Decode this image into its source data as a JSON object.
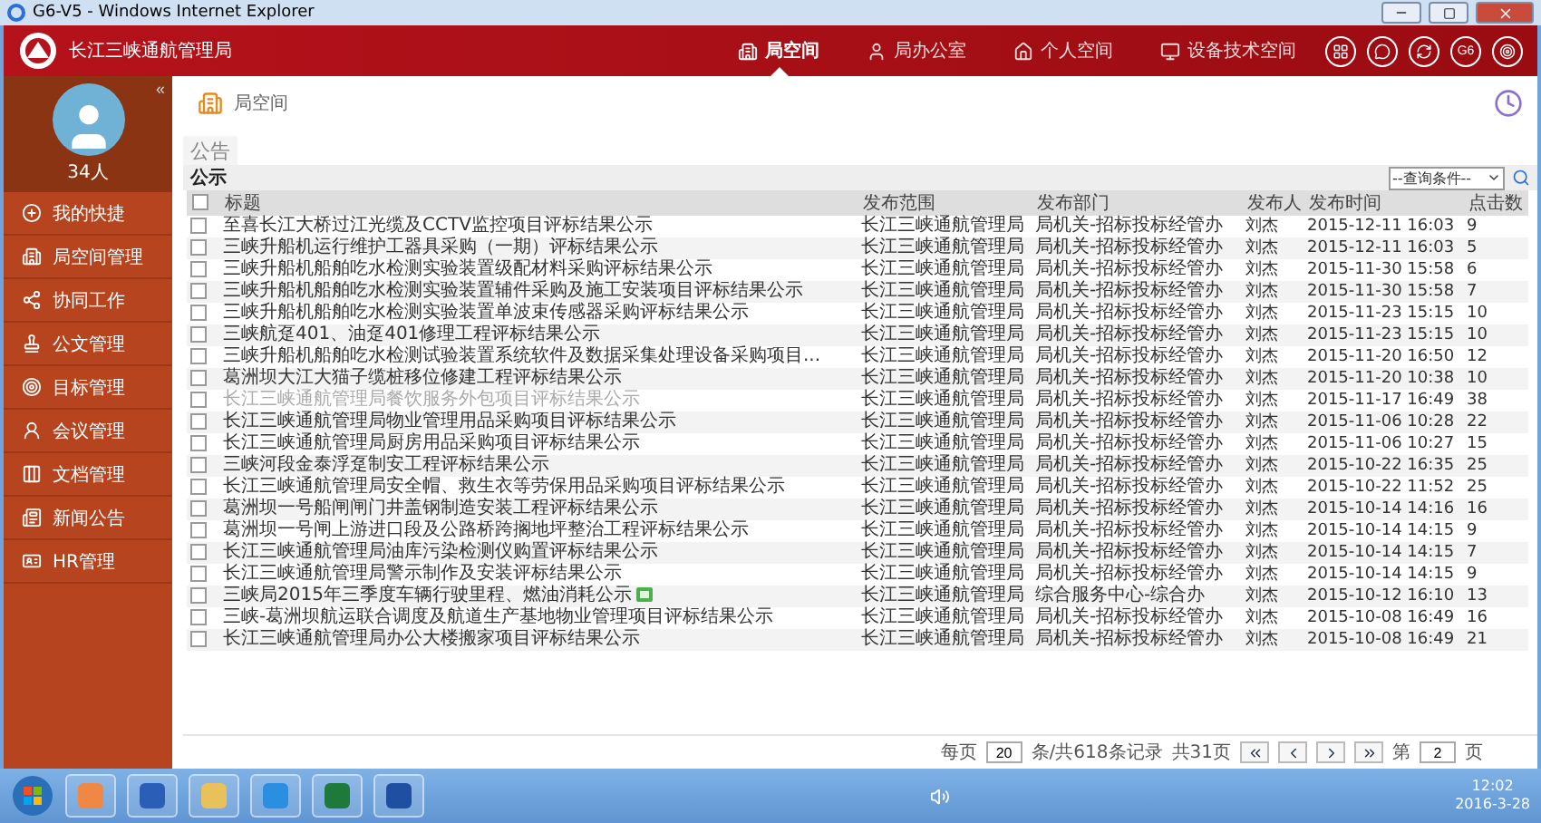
{
  "window": {
    "title": "G6-V5 - Windows Internet Explorer"
  },
  "header": {
    "org_name": "长江三峡通航管理局",
    "nav": [
      {
        "label": "局空间",
        "selected": true
      },
      {
        "label": "局办公室",
        "selected": false
      },
      {
        "label": "个人空间",
        "selected": false
      },
      {
        "label": "设备技术空间",
        "selected": false
      }
    ],
    "badge_text": "G6"
  },
  "sidebar": {
    "collapse": "«",
    "online": "34人",
    "items": [
      {
        "label": "我的快捷"
      },
      {
        "label": "局空间管理"
      },
      {
        "label": "协同工作"
      },
      {
        "label": "公文管理"
      },
      {
        "label": "目标管理"
      },
      {
        "label": "会议管理"
      },
      {
        "label": "文档管理"
      },
      {
        "label": "新闻公告"
      },
      {
        "label": "HR管理"
      }
    ]
  },
  "breadcrumb": "局空间",
  "section_title": "公告",
  "panel": {
    "title": "公示",
    "query_placeholder": "--查询条件--"
  },
  "table": {
    "select_all_checked": false,
    "columns": [
      "标题",
      "发布范围",
      "发布部门",
      "发布人",
      "发布时间",
      "点击数"
    ],
    "rows": [
      {
        "checked": false,
        "visited": false,
        "is_new": false,
        "cells": [
          "至喜长江大桥过江光缆及CCTV监控项目评标结果公示",
          "长江三峡通航管理局",
          "局机关-招标投标经管办",
          "刘杰",
          "2015-12-11 16:03",
          "9"
        ]
      },
      {
        "checked": false,
        "visited": false,
        "is_new": false,
        "cells": [
          "三峡升船机运行维护工器具采购（一期）评标结果公示",
          "长江三峡通航管理局",
          "局机关-招标投标经管办",
          "刘杰",
          "2015-12-11 16:03",
          "5"
        ]
      },
      {
        "checked": false,
        "visited": false,
        "is_new": false,
        "cells": [
          "三峡升船机船舶吃水检测实验装置级配材料采购评标结果公示",
          "长江三峡通航管理局",
          "局机关-招标投标经管办",
          "刘杰",
          "2015-11-30 15:58",
          "6"
        ]
      },
      {
        "checked": false,
        "visited": false,
        "is_new": false,
        "cells": [
          "三峡升船机船舶吃水检测实验装置辅件采购及施工安装项目评标结果公示",
          "长江三峡通航管理局",
          "局机关-招标投标经管办",
          "刘杰",
          "2015-11-30 15:58",
          "7"
        ]
      },
      {
        "checked": false,
        "visited": false,
        "is_new": false,
        "cells": [
          "三峡升船机船舶吃水检测实验装置单波束传感器采购评标结果公示",
          "长江三峡通航管理局",
          "局机关-招标投标经管办",
          "刘杰",
          "2015-11-23 15:15",
          "10"
        ]
      },
      {
        "checked": false,
        "visited": false,
        "is_new": false,
        "cells": [
          "三峡航趸401、油趸401修理工程评标结果公示",
          "长江三峡通航管理局",
          "局机关-招标投标经管办",
          "刘杰",
          "2015-11-23 15:15",
          "10"
        ]
      },
      {
        "checked": false,
        "visited": false,
        "is_new": false,
        "cells": [
          "三峡升船机船舶吃水检测试验装置系统软件及数据采集处理设备采购项目...",
          "长江三峡通航管理局",
          "局机关-招标投标经管办",
          "刘杰",
          "2015-11-20 16:50",
          "12"
        ]
      },
      {
        "checked": false,
        "visited": false,
        "is_new": false,
        "cells": [
          "葛洲坝大江大猫子缆桩移位修建工程评标结果公示",
          "长江三峡通航管理局",
          "局机关-招标投标经管办",
          "刘杰",
          "2015-11-20 10:38",
          "10"
        ]
      },
      {
        "checked": false,
        "visited": true,
        "is_new": false,
        "cells": [
          "长江三峡通航管理局餐饮服务外包项目评标结果公示",
          "长江三峡通航管理局",
          "局机关-招标投标经管办",
          "刘杰",
          "2015-11-17 16:49",
          "38"
        ]
      },
      {
        "checked": false,
        "visited": false,
        "is_new": false,
        "cells": [
          "长江三峡通航管理局物业管理用品采购项目评标结果公示",
          "长江三峡通航管理局",
          "局机关-招标投标经管办",
          "刘杰",
          "2015-11-06 10:28",
          "22"
        ]
      },
      {
        "checked": false,
        "visited": false,
        "is_new": false,
        "cells": [
          "长江三峡通航管理局厨房用品采购项目评标结果公示",
          "长江三峡通航管理局",
          "局机关-招标投标经管办",
          "刘杰",
          "2015-11-06 10:27",
          "15"
        ]
      },
      {
        "checked": false,
        "visited": false,
        "is_new": false,
        "cells": [
          "三峡河段金泰浮趸制安工程评标结果公示",
          "长江三峡通航管理局",
          "局机关-招标投标经管办",
          "刘杰",
          "2015-10-22 16:35",
          "25"
        ]
      },
      {
        "checked": false,
        "visited": false,
        "is_new": false,
        "cells": [
          "长江三峡通航管理局安全帽、救生衣等劳保用品采购项目评标结果公示",
          "长江三峡通航管理局",
          "局机关-招标投标经管办",
          "刘杰",
          "2015-10-22 11:52",
          "25"
        ]
      },
      {
        "checked": false,
        "visited": false,
        "is_new": false,
        "cells": [
          "葛洲坝一号船闸闸门井盖钢制造安装工程评标结果公示",
          "长江三峡通航管理局",
          "局机关-招标投标经管办",
          "刘杰",
          "2015-10-14 14:16",
          "16"
        ]
      },
      {
        "checked": false,
        "visited": false,
        "is_new": false,
        "cells": [
          "葛洲坝一号闸上游进口段及公路桥跨搁地坪整治工程评标结果公示",
          "长江三峡通航管理局",
          "局机关-招标投标经管办",
          "刘杰",
          "2015-10-14 14:15",
          "9"
        ]
      },
      {
        "checked": false,
        "visited": false,
        "is_new": false,
        "cells": [
          "长江三峡通航管理局油库污染检测仪购置评标结果公示",
          "长江三峡通航管理局",
          "局机关-招标投标经管办",
          "刘杰",
          "2015-10-14 14:15",
          "7"
        ]
      },
      {
        "checked": false,
        "visited": false,
        "is_new": false,
        "cells": [
          "长江三峡通航管理局警示制作及安装评标结果公示",
          "长江三峡通航管理局",
          "局机关-招标投标经管办",
          "刘杰",
          "2015-10-14 14:15",
          "9"
        ]
      },
      {
        "checked": false,
        "visited": false,
        "is_new": true,
        "cells": [
          "三峡局2015年三季度车辆行驶里程、燃油消耗公示",
          "长江三峡通航管理局",
          "综合服务中心-综合办",
          "刘杰",
          "2015-10-12 16:10",
          "13"
        ]
      },
      {
        "checked": false,
        "visited": false,
        "is_new": false,
        "cells": [
          "三峡-葛洲坝航运联合调度及航道生产基地物业管理项目评标结果公示",
          "长江三峡通航管理局",
          "局机关-招标投标经管办",
          "刘杰",
          "2015-10-08 16:49",
          "16"
        ]
      },
      {
        "checked": false,
        "visited": false,
        "is_new": false,
        "cells": [
          "长江三峡通航管理局办公大楼搬家项目评标结果公示",
          "长江三峡通航管理局",
          "局机关-招标投标经管办",
          "刘杰",
          "2015-10-08 16:49",
          "21"
        ]
      }
    ]
  },
  "pagination": {
    "per_page_label": "每页",
    "per_page": "20",
    "records": "条/共618条记录",
    "pages": "共31页",
    "page_prefix": "第",
    "page": "2",
    "page_suffix": "页"
  },
  "taskbar": {
    "time": "12:02",
    "date": "2016-3-28"
  }
}
